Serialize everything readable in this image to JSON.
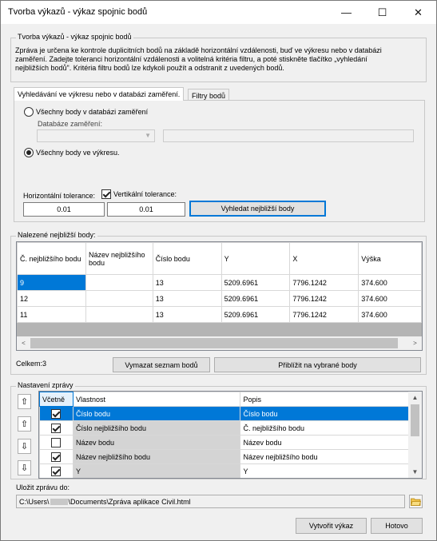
{
  "window": {
    "title": "Tvorba výkazů - výkaz spojnic bodů",
    "minimize": "—",
    "maximize": "☐",
    "close": "✕"
  },
  "intro": {
    "legend": "Tvorba výkazů - výkaz spojnic bodů",
    "text_line1": "Zpráva je určena ke kontrole duplicitních bodů na základě horizontální vzdálenosti, buď ve výkresu nebo v databázi",
    "text_line2": "zaměření.  Zadejte toleranci horizontální vzdálenosti a volitelná kritéria filtru, a poté stiskněte tlačítko „vyhledání",
    "text_line3": "nejbližších bodů\". Kritéria filtru bodů lze kdykoli použít a odstranit z uvedených bodů."
  },
  "tabs": {
    "search": "Vyhledávání ve výkresu nebo v databázi zaměření.",
    "filters": "Filtry bodů"
  },
  "search": {
    "radio_db": "Všechny body v databázi zaměření",
    "db_label": "Databáze zaměření:",
    "radio_drawing": "Všechny body ve výkresu.",
    "htol_label": "Horizontální tolerance:",
    "vtol_label": "Vertikální tolerance:",
    "htol_value": "0.01",
    "vtol_value": "0.01",
    "find_button": "Vyhledat nejbližší body"
  },
  "results": {
    "legend": "Nalezené nejbližší body:",
    "columns": [
      "Č. nejbližšího bodu",
      "Název nejbližšího bodu",
      "Číslo bodu",
      "Y",
      "X",
      "Výška"
    ],
    "rows": [
      [
        "9",
        "",
        "13",
        "5209.6961",
        "7796.1242",
        "374.600"
      ],
      [
        "12",
        "",
        "13",
        "5209.6961",
        "7796.1242",
        "374.600"
      ],
      [
        "11",
        "",
        "13",
        "5209.6961",
        "7796.1242",
        "374.600"
      ]
    ],
    "total": "Celkem:3",
    "clear_button": "Vymazat seznam bodů",
    "zoom_button": "Přiblížit na vybrané body"
  },
  "report": {
    "legend": "Nastavení zprávy",
    "columns": [
      "Včetně",
      "Vlastnost",
      "Popis"
    ],
    "rows": [
      {
        "checked": true,
        "property": "Číslo bodu",
        "description": "Číslo bodu"
      },
      {
        "checked": true,
        "property": "Číslo nejbližšího bodu",
        "description": "Č. nejbližšího bodu"
      },
      {
        "checked": false,
        "property": "Název bodu",
        "description": "Název bodu"
      },
      {
        "checked": true,
        "property": "Název nejbližšího bodu",
        "description": "Název nejbližšího bodu"
      },
      {
        "checked": true,
        "property": "Y",
        "description": "Y"
      }
    ]
  },
  "save": {
    "label": "Uložit zprávu do:",
    "path_prefix": "C:\\Users\\",
    "path_suffix": "\\Documents\\Zpráva aplikace Civil.html"
  },
  "footer": {
    "create_button": "Vytvořit výkaz",
    "done_button": "Hotovo"
  },
  "colors": {
    "selection": "#0078d7",
    "grey_cell": "#d4d4d4"
  }
}
